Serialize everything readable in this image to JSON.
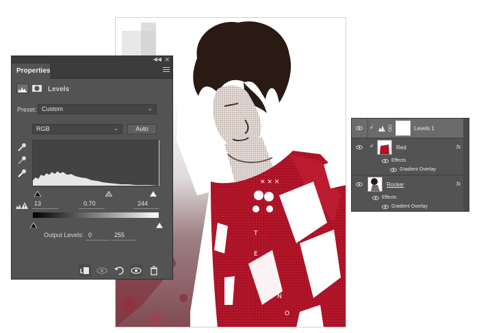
{
  "properties": {
    "tab_label": "Properties",
    "adjustment_title": "Levels",
    "preset_label": "Preset:",
    "preset_value": "Custom",
    "channel_value": "RGB",
    "auto_label": "Auto",
    "input_black": "13",
    "input_gamma": "0.70",
    "input_white": "244",
    "output_label": "Output Levels:",
    "output_black": "0",
    "output_white": "255"
  },
  "layers": {
    "items": [
      {
        "name": "Levels 1",
        "selected": true
      },
      {
        "name": "Red",
        "fx": "fx",
        "effects_label": "Effects",
        "effect_name": "Gradient Overlay"
      },
      {
        "name": "Rocker",
        "fx": "fx",
        "effects_label": "Effects",
        "effect_name": "Gradient Overlay"
      }
    ]
  },
  "colors": {
    "panel_bg": "#535353",
    "panel_dark": "#3b3b3b",
    "selected_row": "#6b6b6b",
    "shirt_red": "#b01227",
    "hair_dark": "#2a1a14"
  },
  "icons": [
    "collapse-icon",
    "close-icon",
    "panel-menu-icon",
    "levels-icon",
    "mask-icon",
    "eyedropper-black-icon",
    "eyedropper-gray-icon",
    "eyedropper-white-icon",
    "warning-icon",
    "clip-to-layer-icon",
    "view-previous-icon",
    "reset-icon",
    "visibility-icon",
    "trash-icon",
    "eye-icon",
    "link-icon",
    "fx-icon"
  ]
}
